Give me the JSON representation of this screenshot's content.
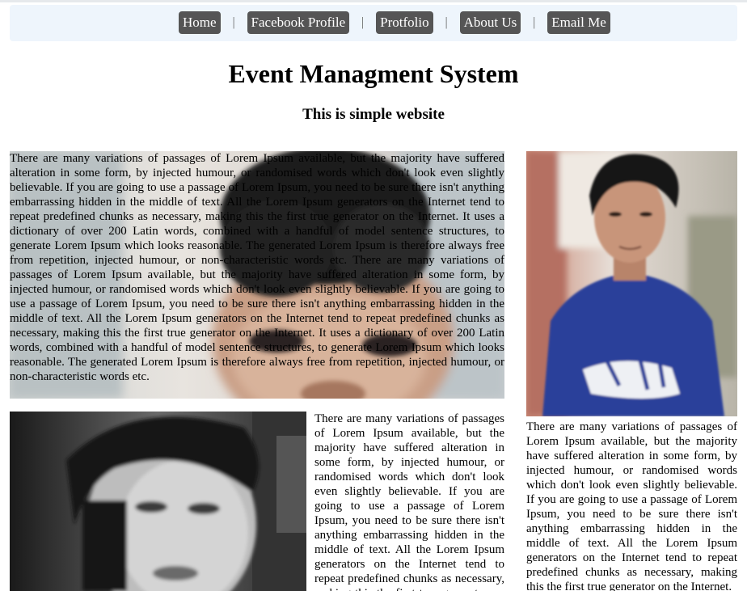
{
  "nav": {
    "items": [
      {
        "label": "Home"
      },
      {
        "label": "Facebook Profile"
      },
      {
        "label": "Protfolio"
      },
      {
        "label": "About Us"
      },
      {
        "label": "Email Me"
      }
    ],
    "separator": "|"
  },
  "header": {
    "title": "Event Managment System",
    "subtitle": "This is simple website"
  },
  "content": {
    "hero_paragraph": "There are many variations of passages of Lorem Ipsum available, but the majority have suffered alteration in some form, by injected humour, or randomised words which don't look even slightly believable. If you are going to use a passage of Lorem Ipsum, you need to be sure there isn't anything embarrassing hidden in the middle of text. All the Lorem Ipsum generators on the Internet tend to repeat predefined chunks as necessary, making this the first true generator on the Internet. It uses a dictionary of over 200 Latin words, combined with a handful of model sentence structures, to generate Lorem Ipsum which looks reasonable. The generated Lorem Ipsum is therefore always free from repetition, injected humour, or non-characteristic words etc. There are many variations of passages of Lorem Ipsum available, but the majority have suffered alteration in some form, by injected humour, or randomised words which don't look even slightly believable. If you are going to use a passage of Lorem Ipsum, you need to be sure there isn't anything embarrassing hidden in the middle of text. All the Lorem Ipsum generators on the Internet tend to repeat predefined chunks as necessary, making this the first true generator on the Internet. It uses a dictionary of over 200 Latin words, combined with a handful of model sentence structures, to generate Lorem Ipsum which looks reasonable. The generated Lorem Ipsum is therefore always free from repetition, injected humour, or non-characteristic words etc.",
    "middle_paragraph": "There are many variations of passages of Lorem Ipsum available, but the majority have suffered alteration in some form, by injected humour, or randomised words which don't look even slightly believable. If you are going to use a passage of Lorem Ipsum, you need to be sure there isn't anything embarrassing hidden in the middle of text. All the Lorem Ipsum generators on the Internet tend to repeat predefined chunks as necessary, making this the first true generator on the Internet.",
    "side_paragraph": "There are many variations of passages of Lorem Ipsum available, but the majority have suffered alteration in some form, by injected humour, or randomised words which don't look even slightly believable. If you are going to use a passage of Lorem Ipsum, you need to be sure there isn't anything embarrassing hidden in the middle of text. All the Lorem Ipsum generators on the Internet tend to repeat predefined chunks as necessary, making this the first true generator on the Internet."
  },
  "colors": {
    "nav_button_bg": "#555555",
    "nav_button_text": "#ffffff",
    "navbar_bg": "#eef5fc",
    "shirt_blue": "#2b3f9a"
  }
}
